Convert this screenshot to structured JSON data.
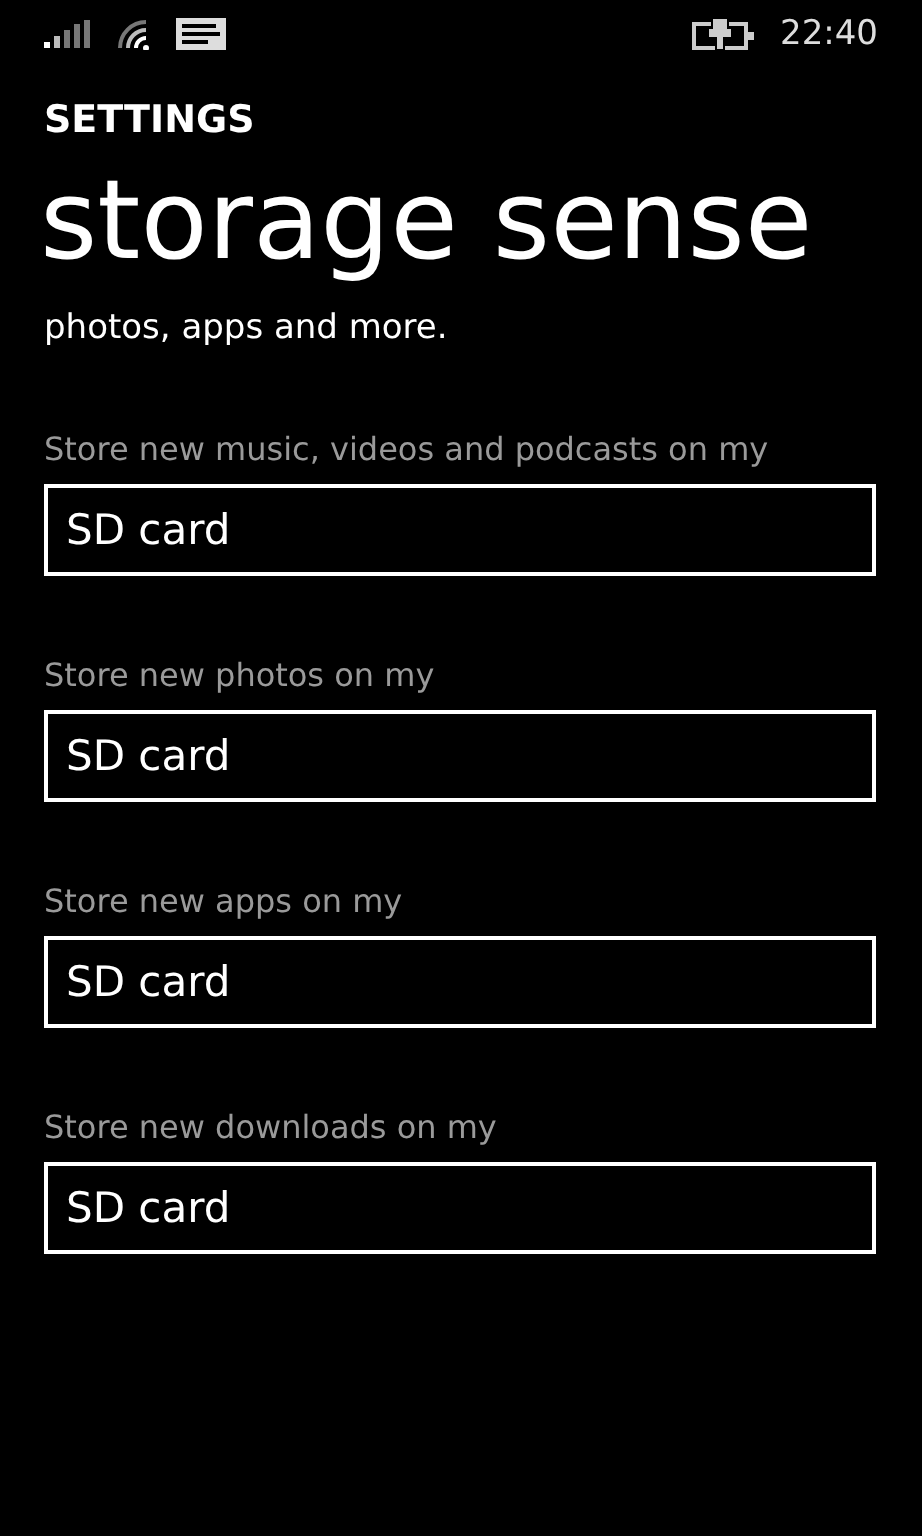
{
  "status_bar": {
    "time": "22:40"
  },
  "header": {
    "app": "SETTINGS",
    "title": "storage sense"
  },
  "intro_partial": "photos, apps and more.",
  "settings": [
    {
      "label": "Store new music, videos and podcasts on my",
      "value": "SD card"
    },
    {
      "label": "Store new photos on my",
      "value": "SD card"
    },
    {
      "label": "Store new apps on my",
      "value": "SD card"
    },
    {
      "label": "Store new downloads on my",
      "value": "SD card"
    }
  ]
}
